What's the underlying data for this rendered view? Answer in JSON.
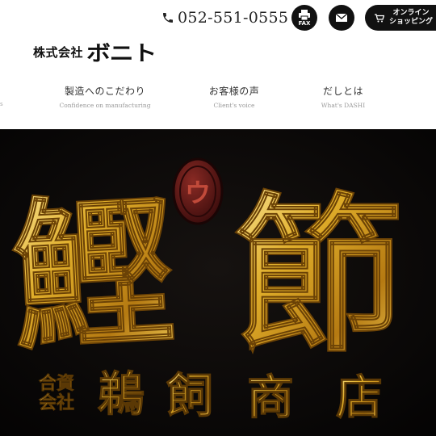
{
  "header": {
    "phone": "052-551-0555",
    "fax_label": "FAX",
    "shop_label_line1": "オンライン",
    "shop_label_line2": "ショッピング"
  },
  "logo": {
    "corp": "株式会社",
    "brand": "ボニト"
  },
  "nav": [
    {
      "jp": "製造へのこだわり",
      "en": "Confidence on manufacturing"
    },
    {
      "jp": "お客様の声",
      "en": "Client's voice"
    },
    {
      "jp": "だしとは",
      "en": "What's DASHI"
    }
  ],
  "nav_edge": "s",
  "hero": {
    "big_char_left": "鰹",
    "big_char_right": "節",
    "emblem_char": "ウ",
    "company_type_top": "合資",
    "company_type_bottom": "会社",
    "company_name": [
      "鵜",
      "飼",
      "商",
      "店"
    ]
  },
  "colors": {
    "gold": "#d9a520",
    "gold_light": "#f7df7a",
    "gold_dark": "#7a4e08",
    "emblem": "#5a1414",
    "accent_black": "#111111"
  }
}
